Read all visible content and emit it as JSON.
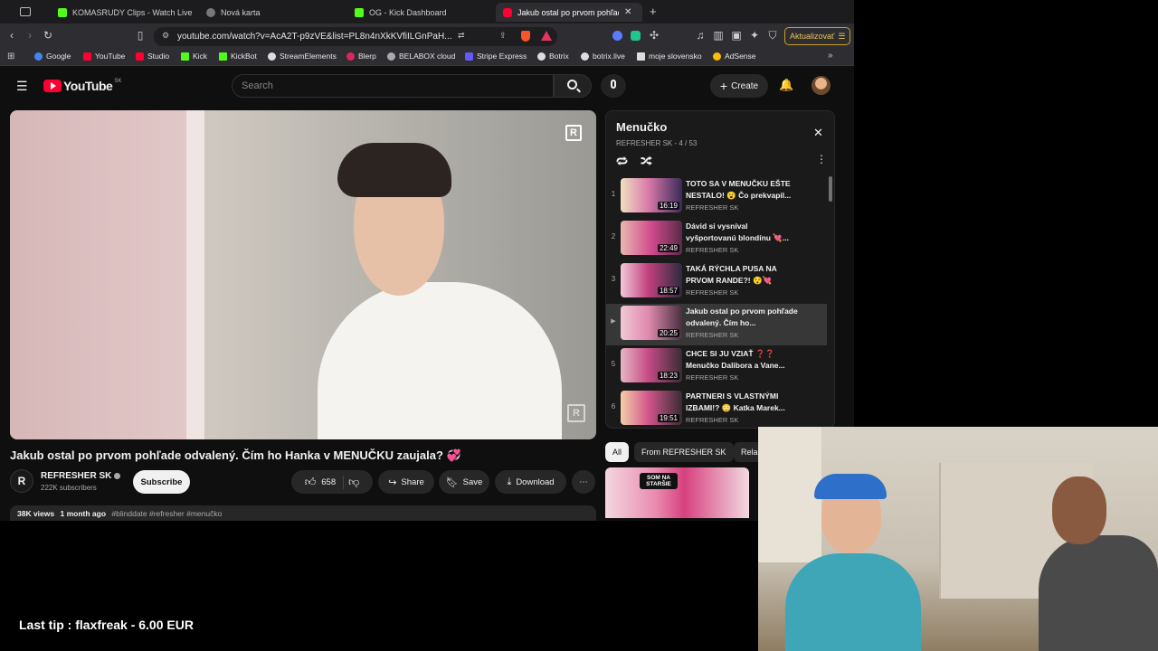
{
  "tabs": [
    {
      "label": "KOMASRUDY Clips - Watch Live o",
      "color": "#53fc18"
    },
    {
      "label": "Nová karta",
      "color": "#888888"
    },
    {
      "label": "OG - Kick Dashboard",
      "color": "#53fc18"
    },
    {
      "label": "Jakub ostal po prvom pohľade",
      "color": "#ff0033"
    }
  ],
  "toolbar": {
    "url": "youtube.com/watch?v=AcA2T-p9zVE&list=PL8n4nXkKVfiILGnPaH...",
    "update_label": "Aktualizovať"
  },
  "bookmarks": [
    {
      "label": "Google",
      "color": "#4285f4"
    },
    {
      "label": "YouTube",
      "color": "#ff0033"
    },
    {
      "label": "Studio",
      "color": "#ff0033"
    },
    {
      "label": "Kick",
      "color": "#53fc18"
    },
    {
      "label": "KickBot",
      "color": "#53fc18"
    },
    {
      "label": "StreamElements",
      "color": "#dddddd"
    },
    {
      "label": "Blerp",
      "color": "#e0245e"
    },
    {
      "label": "BELABOX cloud",
      "color": "#aaaaaa"
    },
    {
      "label": "Stripe Express",
      "color": "#635bff"
    },
    {
      "label": "Botrix",
      "color": "#dddddd"
    },
    {
      "label": "botrix.live",
      "color": "#dddddd"
    },
    {
      "label": "moje slovensko",
      "color": "#dddddd"
    },
    {
      "label": "AdSense",
      "color": "#fbbc04"
    }
  ],
  "header": {
    "logo": "YouTube",
    "region": "SK",
    "search_placeholder": "Search",
    "create_label": "Create"
  },
  "video": {
    "title": "Jakub ostal po prvom pohľade odvalený. Čím ho Hanka v MENUČKU zaujala? 💞",
    "channel": "REFRESHER SK",
    "subscribers": "222K subscribers",
    "subscribe_label": "Subscribe",
    "likes": "658",
    "share_label": "Share",
    "save_label": "Save",
    "download_label": "Download",
    "views": "38K views",
    "age": "1 month ago",
    "tags": "#blinddate #refresher #menučko"
  },
  "playlist": {
    "title": "Menučko",
    "meta": "REFRESHER SK - 4 / 53",
    "items": [
      {
        "num": "1",
        "title": "TOTO SA V MENUČKU EŠTE NESTALO! 😮 Čo prekvapil...",
        "channel": "REFRESHER SK",
        "duration": "16:19"
      },
      {
        "num": "2",
        "title": "Dávid si vysníval vyšportovanú blondínu 💘...",
        "channel": "REFRESHER SK",
        "duration": "22:49"
      },
      {
        "num": "3",
        "title": "TAKÁ RÝCHLA PUSA NA PRVOM RANDE?! 😯💘",
        "channel": "REFRESHER SK",
        "duration": "18:57"
      },
      {
        "num": "▶",
        "title": "Jakub ostal po prvom pohľade odvalený. Čím ho...",
        "channel": "REFRESHER SK",
        "duration": "20:25"
      },
      {
        "num": "5",
        "title": "CHCE SI JU VZIAŤ ❓❓ Menučko Dalibora a Vane...",
        "channel": "REFRESHER SK",
        "duration": "18:23"
      },
      {
        "num": "6",
        "title": "PARTNERI S VLASTNÝMI IZBAMI!? 😳 Katka Marek...",
        "channel": "REFRESHER SK",
        "duration": "19:51"
      }
    ]
  },
  "chips": [
    "All",
    "From REFRESHER SK",
    "Rela"
  ],
  "recommended": {
    "thumb_text": "SOM NA STARŠIE"
  },
  "overlay": {
    "tip": "Last tip : flaxfreak - 6.00 EUR"
  }
}
